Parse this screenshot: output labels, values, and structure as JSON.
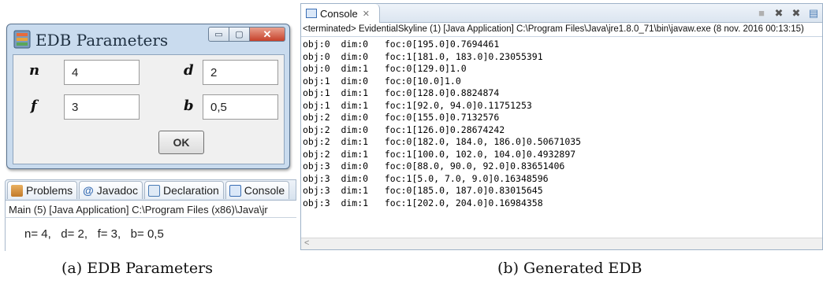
{
  "dialog": {
    "title": "EDB Parameters",
    "buttons": {
      "minimize": "▭",
      "maximize": "▢",
      "close": "✕"
    },
    "params": [
      {
        "label": "n",
        "value": "4"
      },
      {
        "label": "d",
        "value": "2"
      },
      {
        "label": "f",
        "value": "3"
      },
      {
        "label": "b",
        "value": "0,5"
      }
    ],
    "ok_label": "OK"
  },
  "views_bar": {
    "tabs": [
      "Problems",
      "Javadoc",
      "Declaration",
      "Console"
    ]
  },
  "console_a": {
    "main_line": "Main (5) [Java Application] C:\\Program Files (x86)\\Java\\jr",
    "output": "n= 4,   d= 2,   f= 3,   b= 0,5"
  },
  "console_b": {
    "tab_label": "Console",
    "status": "<terminated> EvidentialSkyline (1) [Java Application] C:\\Program Files\\Java\\jre1.8.0_71\\bin\\javaw.exe (8 nov. 2016 00:13:15)",
    "lines": [
      "obj:0  dim:0   foc:0[195.0]0.7694461",
      "obj:0  dim:0   foc:1[181.0, 183.0]0.23055391",
      "obj:0  dim:1   foc:0[129.0]1.0",
      "obj:1  dim:0   foc:0[10.0]1.0",
      "obj:1  dim:1   foc:0[128.0]0.8824874",
      "obj:1  dim:1   foc:1[92.0, 94.0]0.11751253",
      "obj:2  dim:0   foc:0[155.0]0.7132576",
      "obj:2  dim:0   foc:1[126.0]0.28674242",
      "obj:2  dim:1   foc:0[182.0, 184.0, 186.0]0.50671035",
      "obj:2  dim:1   foc:1[100.0, 102.0, 104.0]0.4932897",
      "obj:3  dim:0   foc:0[88.0, 90.0, 92.0]0.83651406",
      "obj:3  dim:0   foc:1[5.0, 7.0, 9.0]0.16348596",
      "obj:3  dim:1   foc:0[185.0, 187.0]0.83015645",
      "obj:3  dim:1   foc:1[202.0, 204.0]0.16984358"
    ]
  },
  "captions": {
    "a": "(a) EDB Parameters",
    "b": "(b) Generated EDB"
  }
}
